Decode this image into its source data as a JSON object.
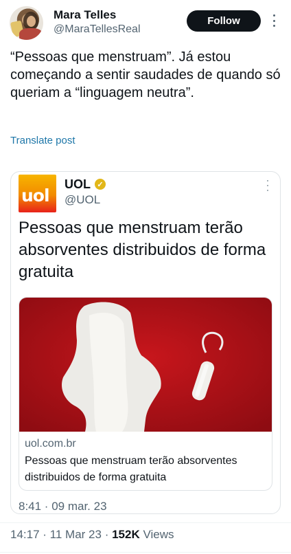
{
  "author": {
    "name": "Mara Telles",
    "handle": "@MaraTellesReal",
    "follow_label": "Follow"
  },
  "tweet": {
    "text": "“Pessoas que menstruam”. Já estou começando a sentir saudades de quando só queriam a “linguagem neutra”.",
    "translate_label": "Translate post",
    "time": "14:17",
    "date": "11 Mar 23",
    "views_count": "152K",
    "views_label": "Views"
  },
  "quoted": {
    "logo_text": "uol",
    "name": "UOL",
    "handle": "@UOL",
    "headline": "Pessoas que menstruam terão absorventes distribuidos de forma gratuita",
    "link_domain": "uol.com.br",
    "link_title": "Pessoas que menstruam terão absorventes distribuidos de forma gratuita",
    "timestamp": "8:41 · 09 mar. 23"
  },
  "colors": {
    "accent_link": "#1d76a8",
    "verified_gold": "#e2b719",
    "photo_background": "#b3141a"
  },
  "icons": {
    "more": "more-vertical-icon",
    "verified": "verified-badge-icon"
  }
}
